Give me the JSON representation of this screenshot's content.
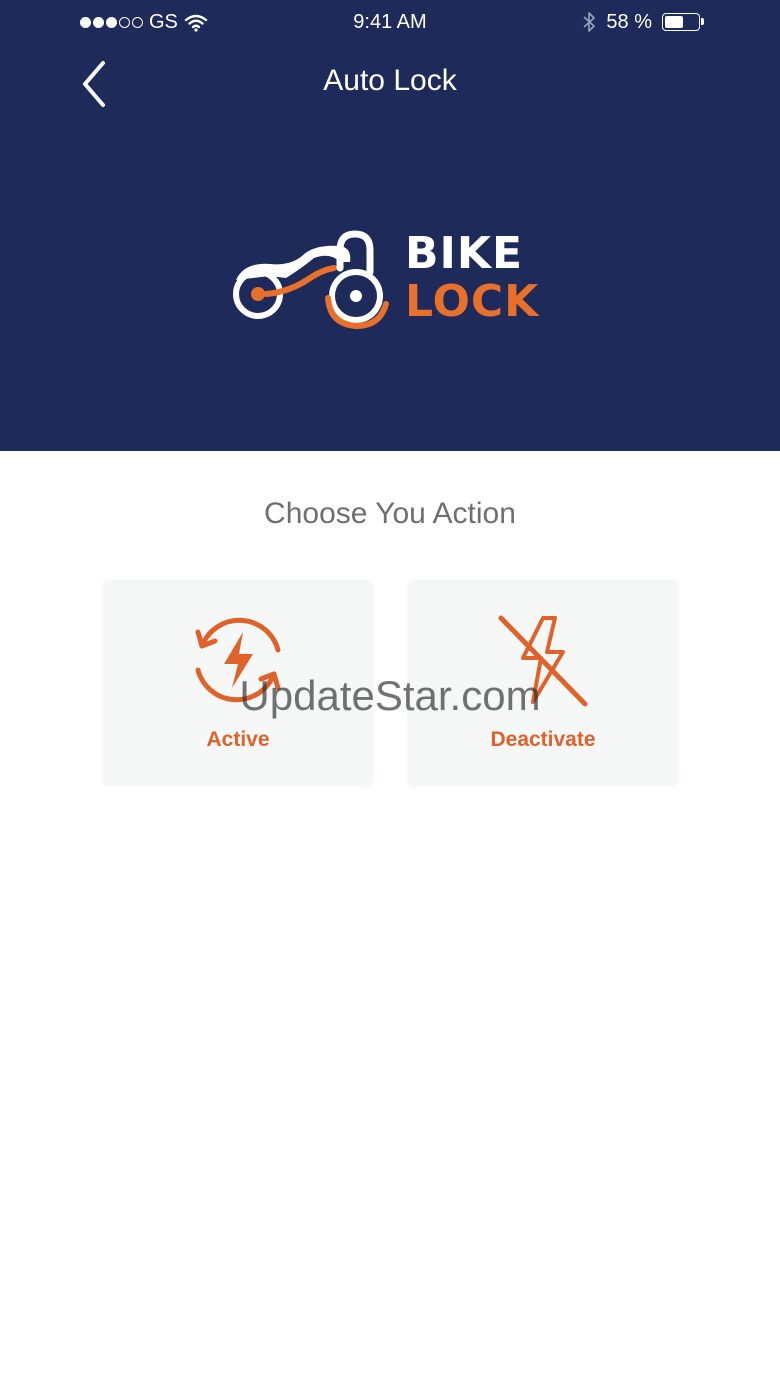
{
  "status_bar": {
    "carrier": "GS",
    "time": "9:41 AM",
    "battery_text": "58 %",
    "battery_level": 0.58,
    "signal_bars_on": 3,
    "signal_bars_total": 5
  },
  "nav": {
    "title": "Auto Lock",
    "back_icon": "chevron-left-icon"
  },
  "logo": {
    "line1": "BIKE",
    "line2": "LOCK"
  },
  "main": {
    "prompt": "Choose You Action",
    "actions": [
      {
        "label": "Active",
        "icon": "refresh-bolt-icon"
      },
      {
        "label": "Deactivate",
        "icon": "bolt-off-icon"
      }
    ]
  },
  "watermark": "UpdateStar.com",
  "colors": {
    "header_bg": "#1d2a5a",
    "accent": "#e0622a",
    "card_bg": "#f6f7f7",
    "prompt_text": "#6f6f6f"
  }
}
